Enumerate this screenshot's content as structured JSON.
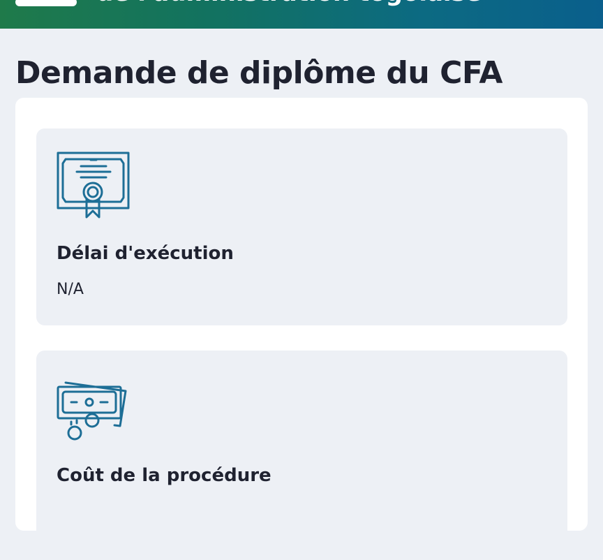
{
  "header": {
    "title": "de l'administration togolaise"
  },
  "page": {
    "title": "Demande de diplôme du CFA"
  },
  "cards": [
    {
      "icon": "certificate-icon",
      "title": "Délai d'exécution",
      "value": "N/A"
    },
    {
      "icon": "money-icon",
      "title": "Coût de la procédure"
    }
  ],
  "colors": {
    "accent": "#1d6e96",
    "header_start": "#1f7a4a",
    "header_end": "#0a5f8c",
    "background": "#edf0f5"
  }
}
